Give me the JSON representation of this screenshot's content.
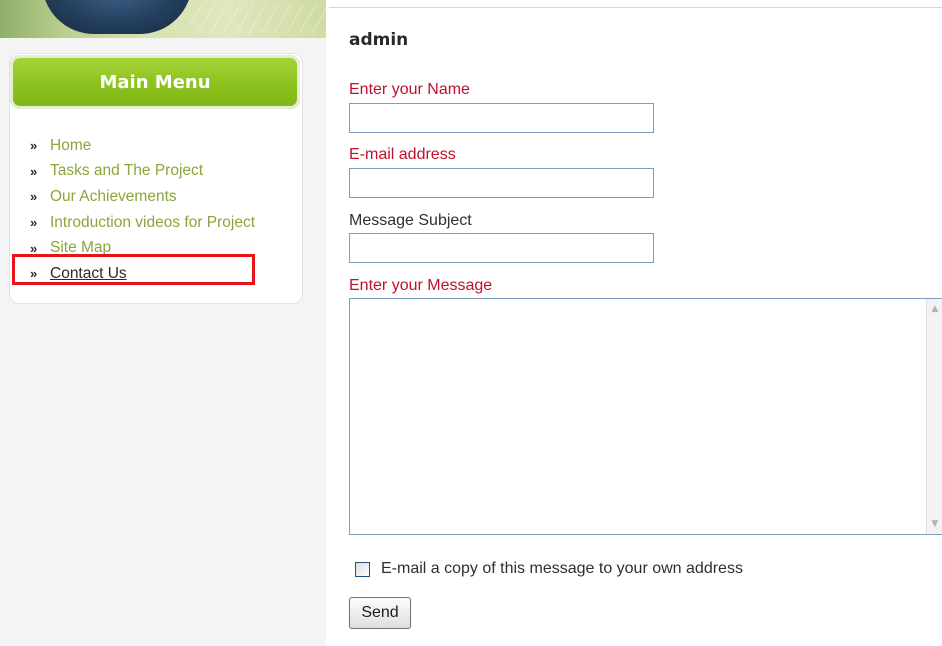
{
  "sidebar": {
    "menu_title": "Main Menu",
    "bullet_glyph": "»",
    "items": [
      {
        "label": "Home"
      },
      {
        "label": "Tasks and The Project"
      },
      {
        "label": "Our Achievements"
      },
      {
        "label": "Introduction videos for Project"
      },
      {
        "label": "Site Map"
      },
      {
        "label": "Contact Us"
      }
    ],
    "active_item": "Contact Us",
    "highlight_color": "#e8121b",
    "accent_color": "#8dc21f",
    "link_color": "#8aa63a"
  },
  "form": {
    "author": "admin",
    "name_label": "Enter your Name",
    "name_value": "",
    "email_label": "E-mail address",
    "email_value": "",
    "subject_label": "Message Subject",
    "subject_value": "",
    "message_label": "Enter your Message",
    "message_value": "",
    "copy_checkbox_label": "E-mail a copy of this message to your own address",
    "copy_checked": false,
    "send_label": "Send",
    "required_label_color": "#c0102a"
  }
}
